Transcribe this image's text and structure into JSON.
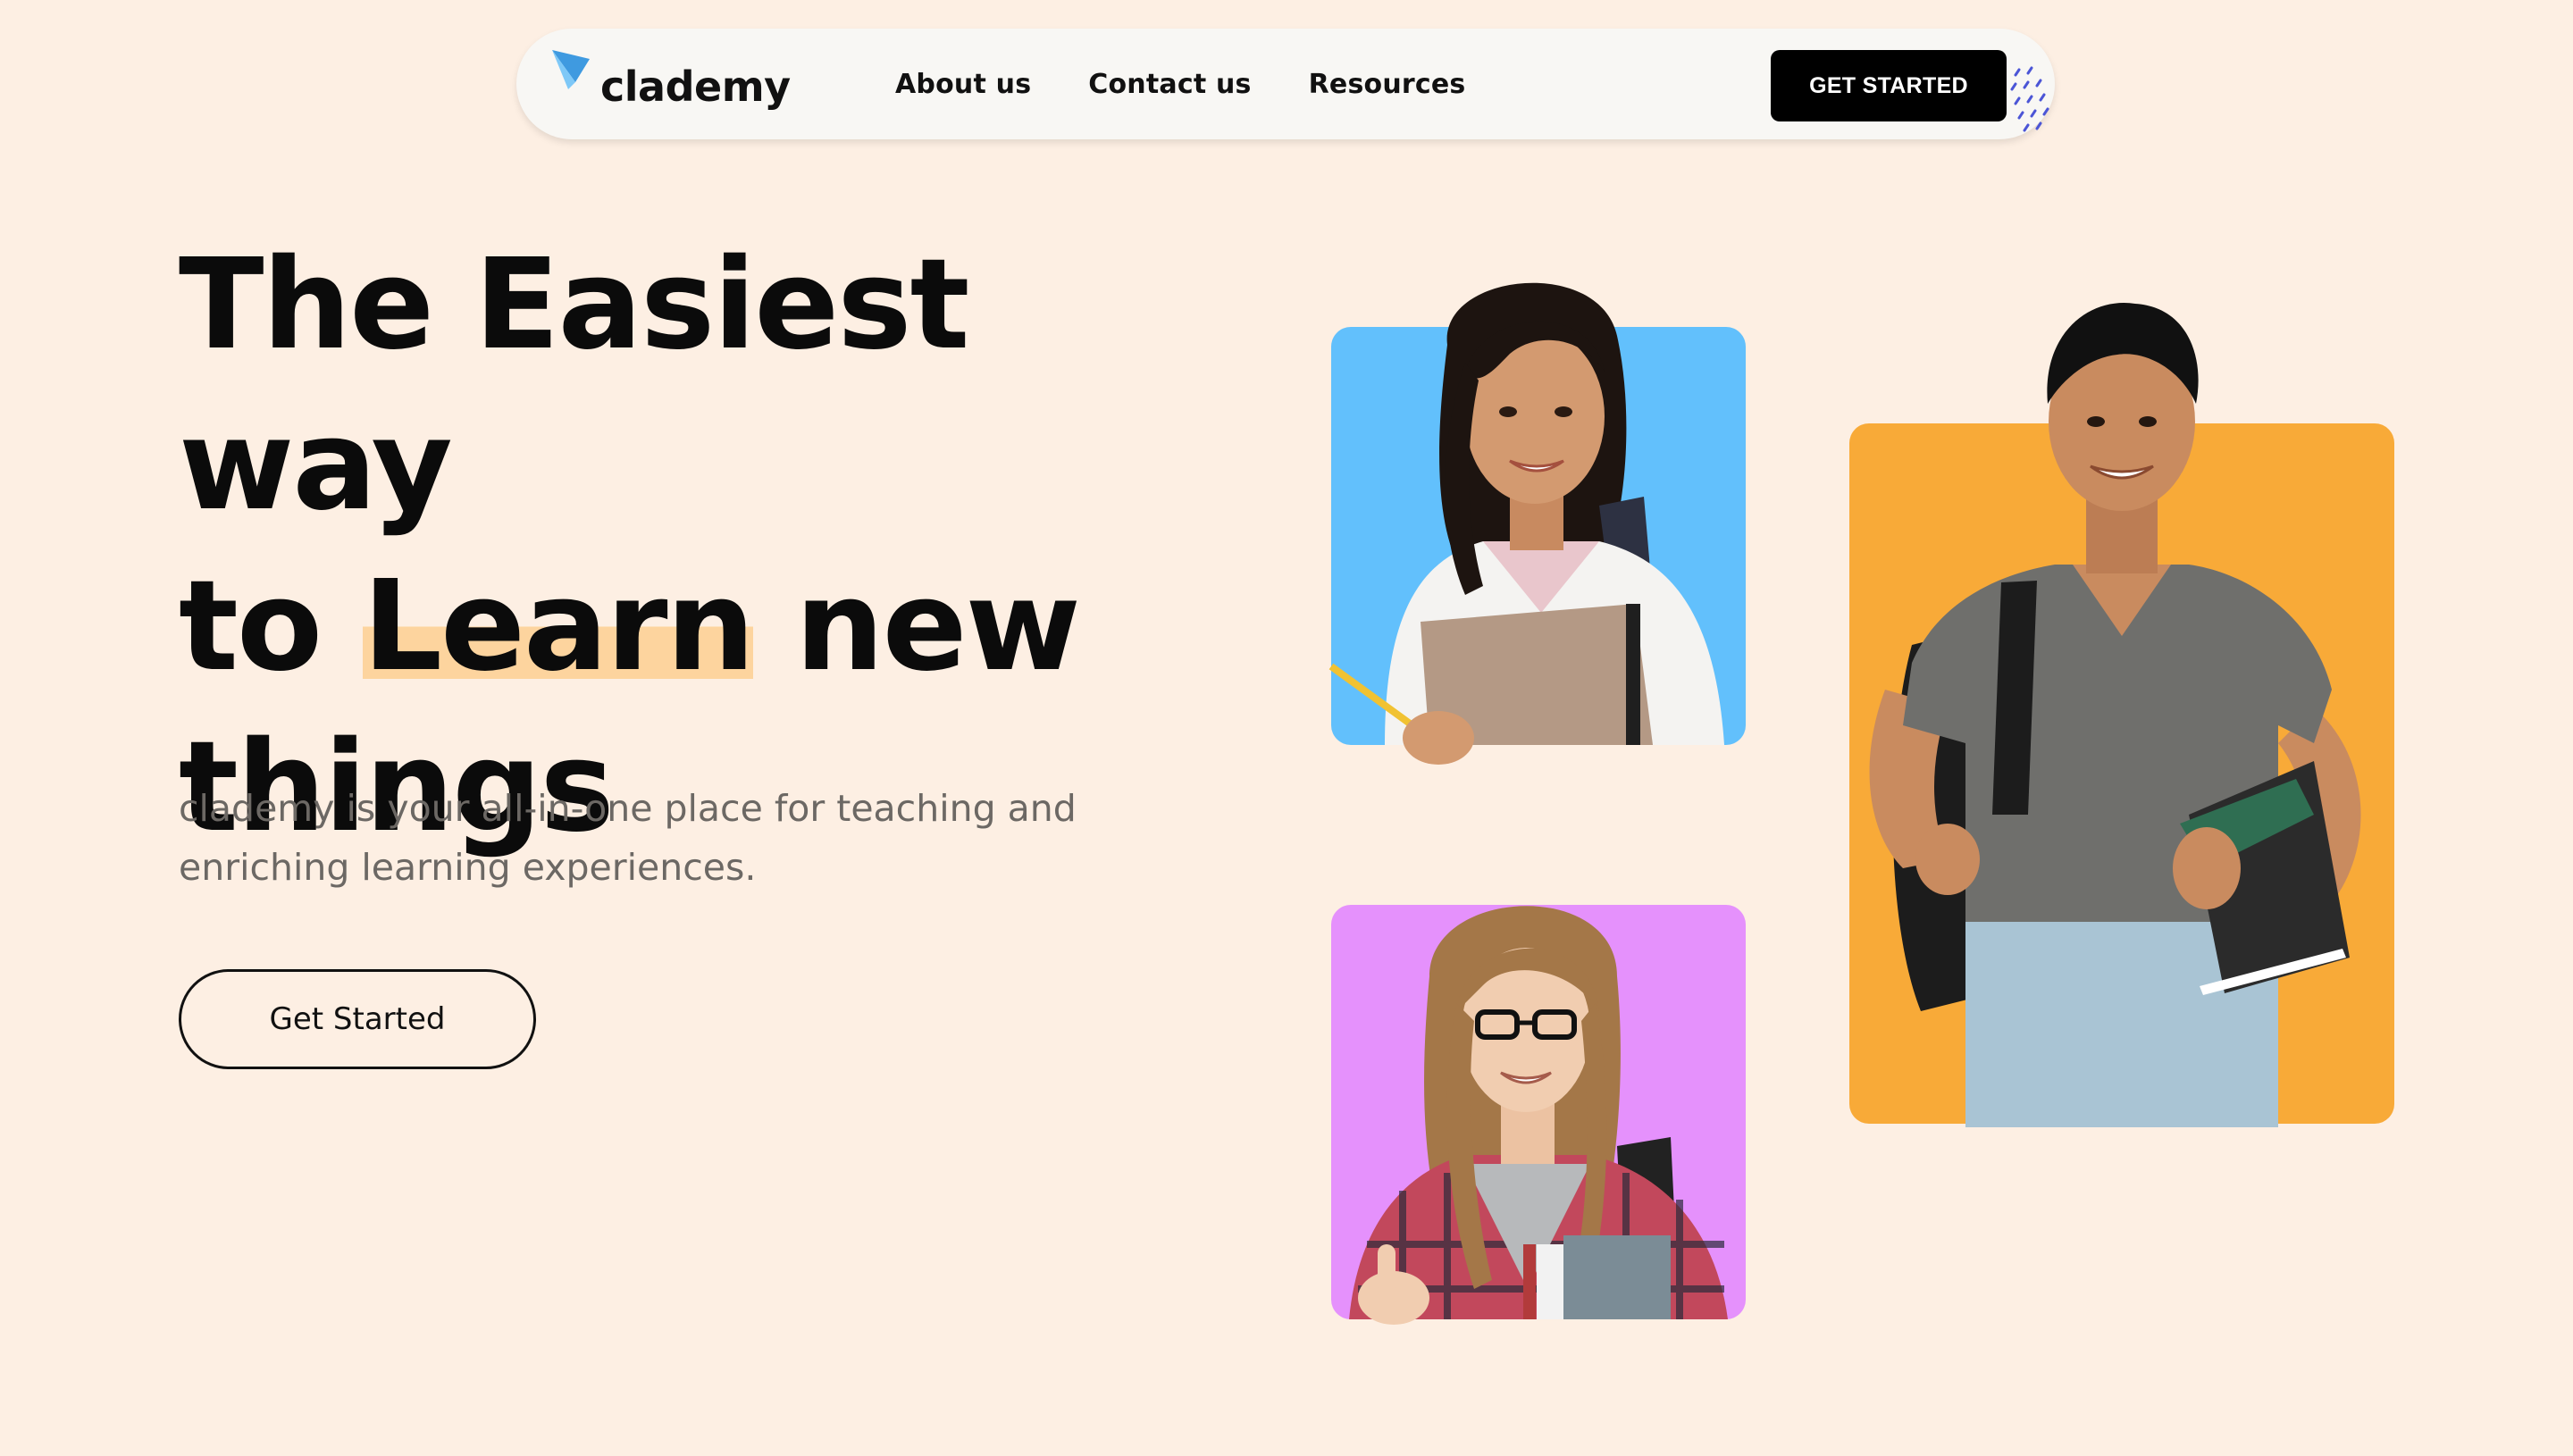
{
  "brand": {
    "name": "clademy",
    "accent": "#4aa8f0"
  },
  "nav": {
    "links": [
      "About us",
      "Contact us",
      "Resources"
    ],
    "cta_label": "GET STARTED"
  },
  "hero": {
    "headline_line1": "The Easiest way",
    "headline_line2_pre": "to ",
    "headline_highlight": "Learn",
    "headline_line2_post": " new",
    "headline_line3": "things",
    "subtitle_line1": "clademy is your all-in-one place for teaching and",
    "subtitle_line2": "enriching learning experiences.",
    "cta_label": "Get Started"
  },
  "colors": {
    "background": "#fdefe3",
    "highlight": "#fdd49e",
    "card_blue": "#62c0fc",
    "card_orange": "#f8aa38",
    "card_purple": "#e591fc"
  }
}
